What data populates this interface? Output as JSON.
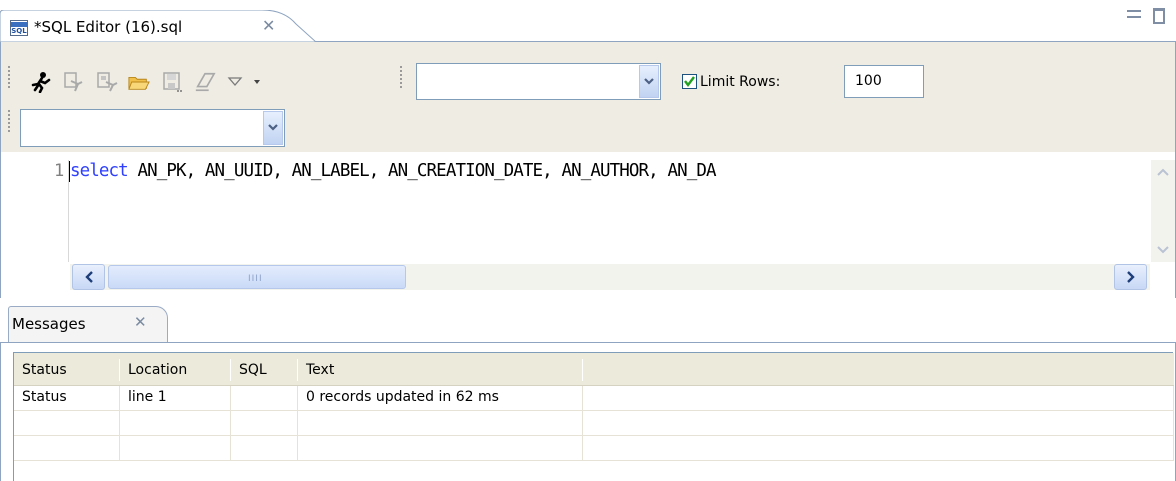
{
  "editor_tab": {
    "icon": "sql-file-icon",
    "label": "*SQL Editor (16).sql",
    "close_icon": "close-icon"
  },
  "window_controls": {
    "minimize_icon": "minimize-icon",
    "maximize_icon": "maximize-icon"
  },
  "toolbar": {
    "icons": [
      "run-icon",
      "run-file-icon",
      "run-selection-icon",
      "open-folder-icon",
      "save-icon",
      "eraser-icon",
      "view-menu-icon",
      "dropdown-icon"
    ],
    "connection_combo_value": "",
    "database_combo_value": "",
    "limit_rows_checked": true,
    "limit_rows_label": "Limit Rows:",
    "limit_rows_value": "100"
  },
  "editor": {
    "line_number": "1",
    "keyword": "select",
    "code_rest": " AN_PK, AN_UUID, AN_LABEL, AN_CREATION_DATE, AN_AUTHOR, AN_DA"
  },
  "messages": {
    "tab_label": "Messages",
    "close_icon": "close-icon",
    "columns": [
      "Status",
      "Location",
      "SQL",
      "Text"
    ],
    "rows": [
      {
        "status": "Status",
        "location": "line 1",
        "sql": "",
        "text": "0 records updated in 62 ms"
      },
      {
        "status": "",
        "location": "",
        "sql": "",
        "text": ""
      },
      {
        "status": "",
        "location": "",
        "sql": "",
        "text": ""
      }
    ]
  },
  "colors": {
    "keyword": "#2f40ff",
    "toolbar_bg": "#eeece3",
    "border": "#8ea4c0"
  }
}
